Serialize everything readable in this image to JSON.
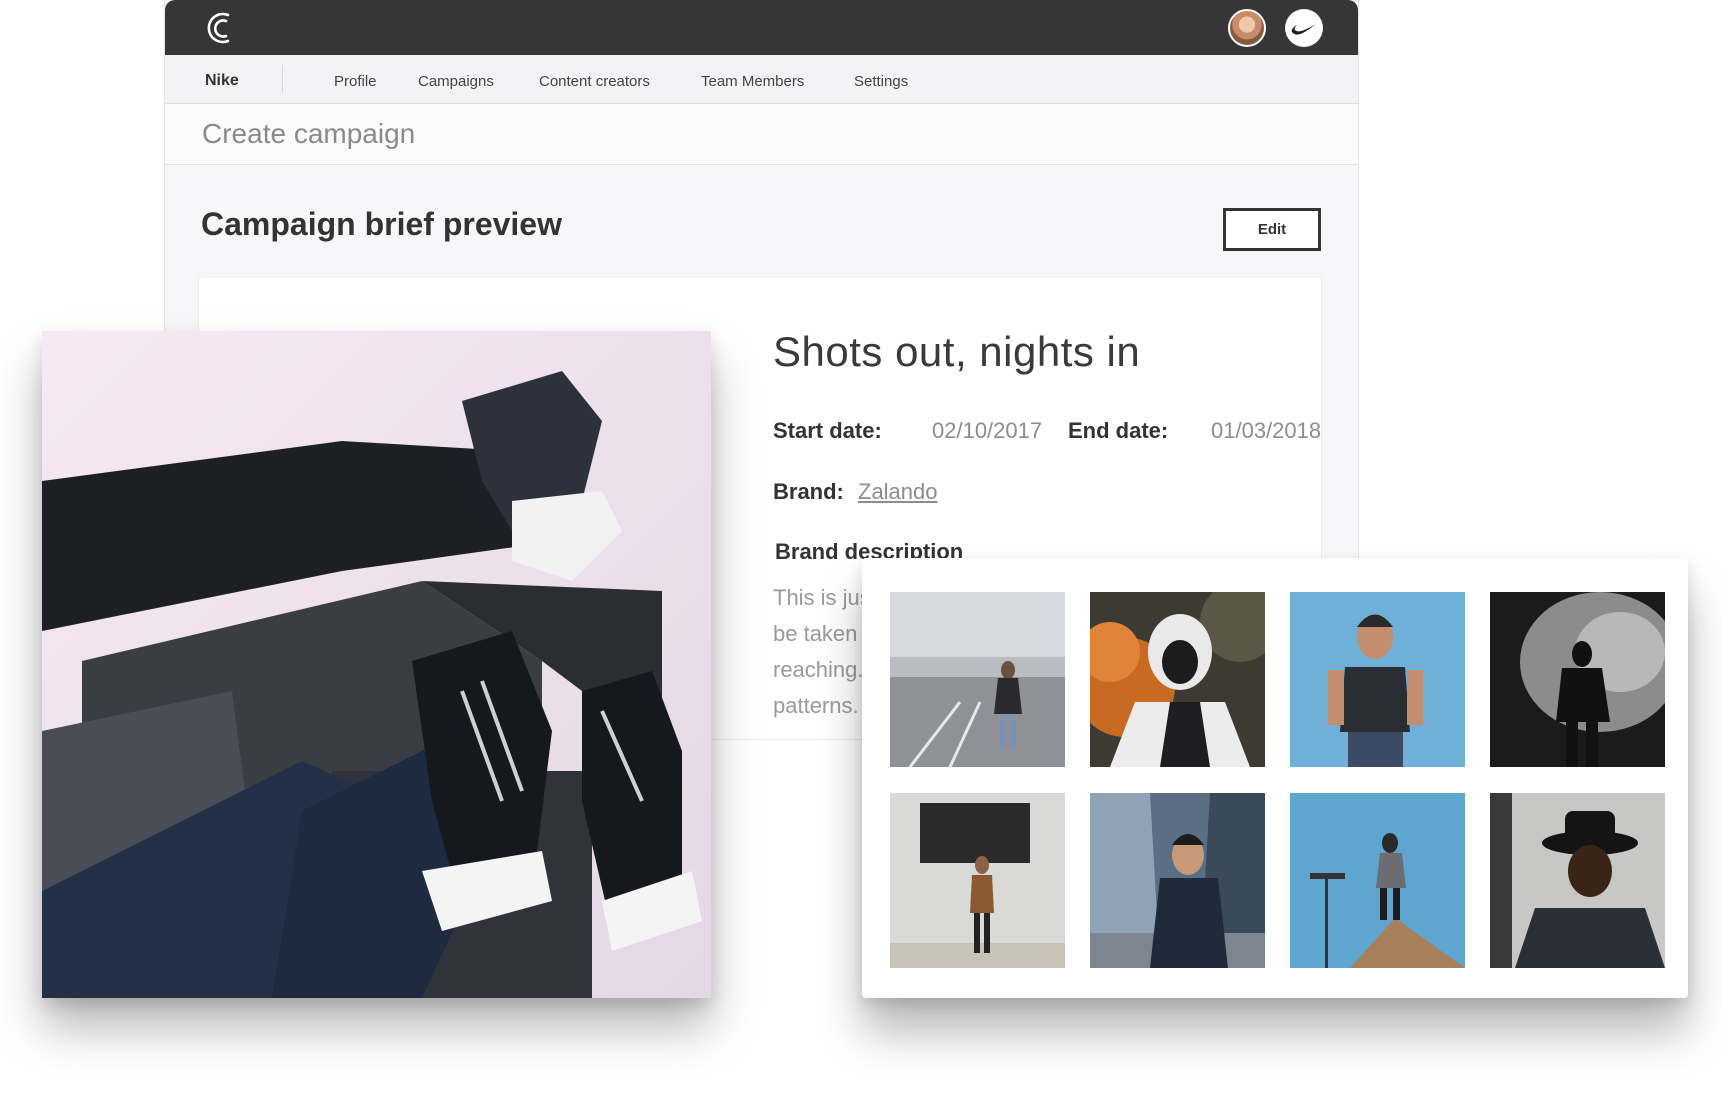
{
  "app": {
    "org_name": "Nike",
    "brand_logo_text": "NIKE"
  },
  "nav": {
    "items": [
      "Profile",
      "Campaigns",
      "Content creators",
      "Team Members",
      "Settings"
    ]
  },
  "page": {
    "header_title": "Create campaign",
    "section_title": "Campaign brief preview",
    "edit_label": "Edit"
  },
  "brief": {
    "title": "Shots out, nights in",
    "start_label": "Start date:",
    "start_value": "02/10/2017",
    "end_label": "End date:",
    "end_value": "01/03/2018",
    "brand_label": "Brand:",
    "brand_value": "Zalando",
    "description_heading": "Brand description",
    "description_lines": [
      "This is jus",
      "be taken",
      "reaching.",
      "patterns."
    ]
  },
  "colors": {
    "topbar": "#363636",
    "nav_background": "#f3f3f5",
    "card_background": "#ffffff",
    "muted_text": "#8d8d8d"
  },
  "icons": {
    "logo": "campaign-c-logo-icon",
    "brand": "nike-swoosh-icon"
  }
}
